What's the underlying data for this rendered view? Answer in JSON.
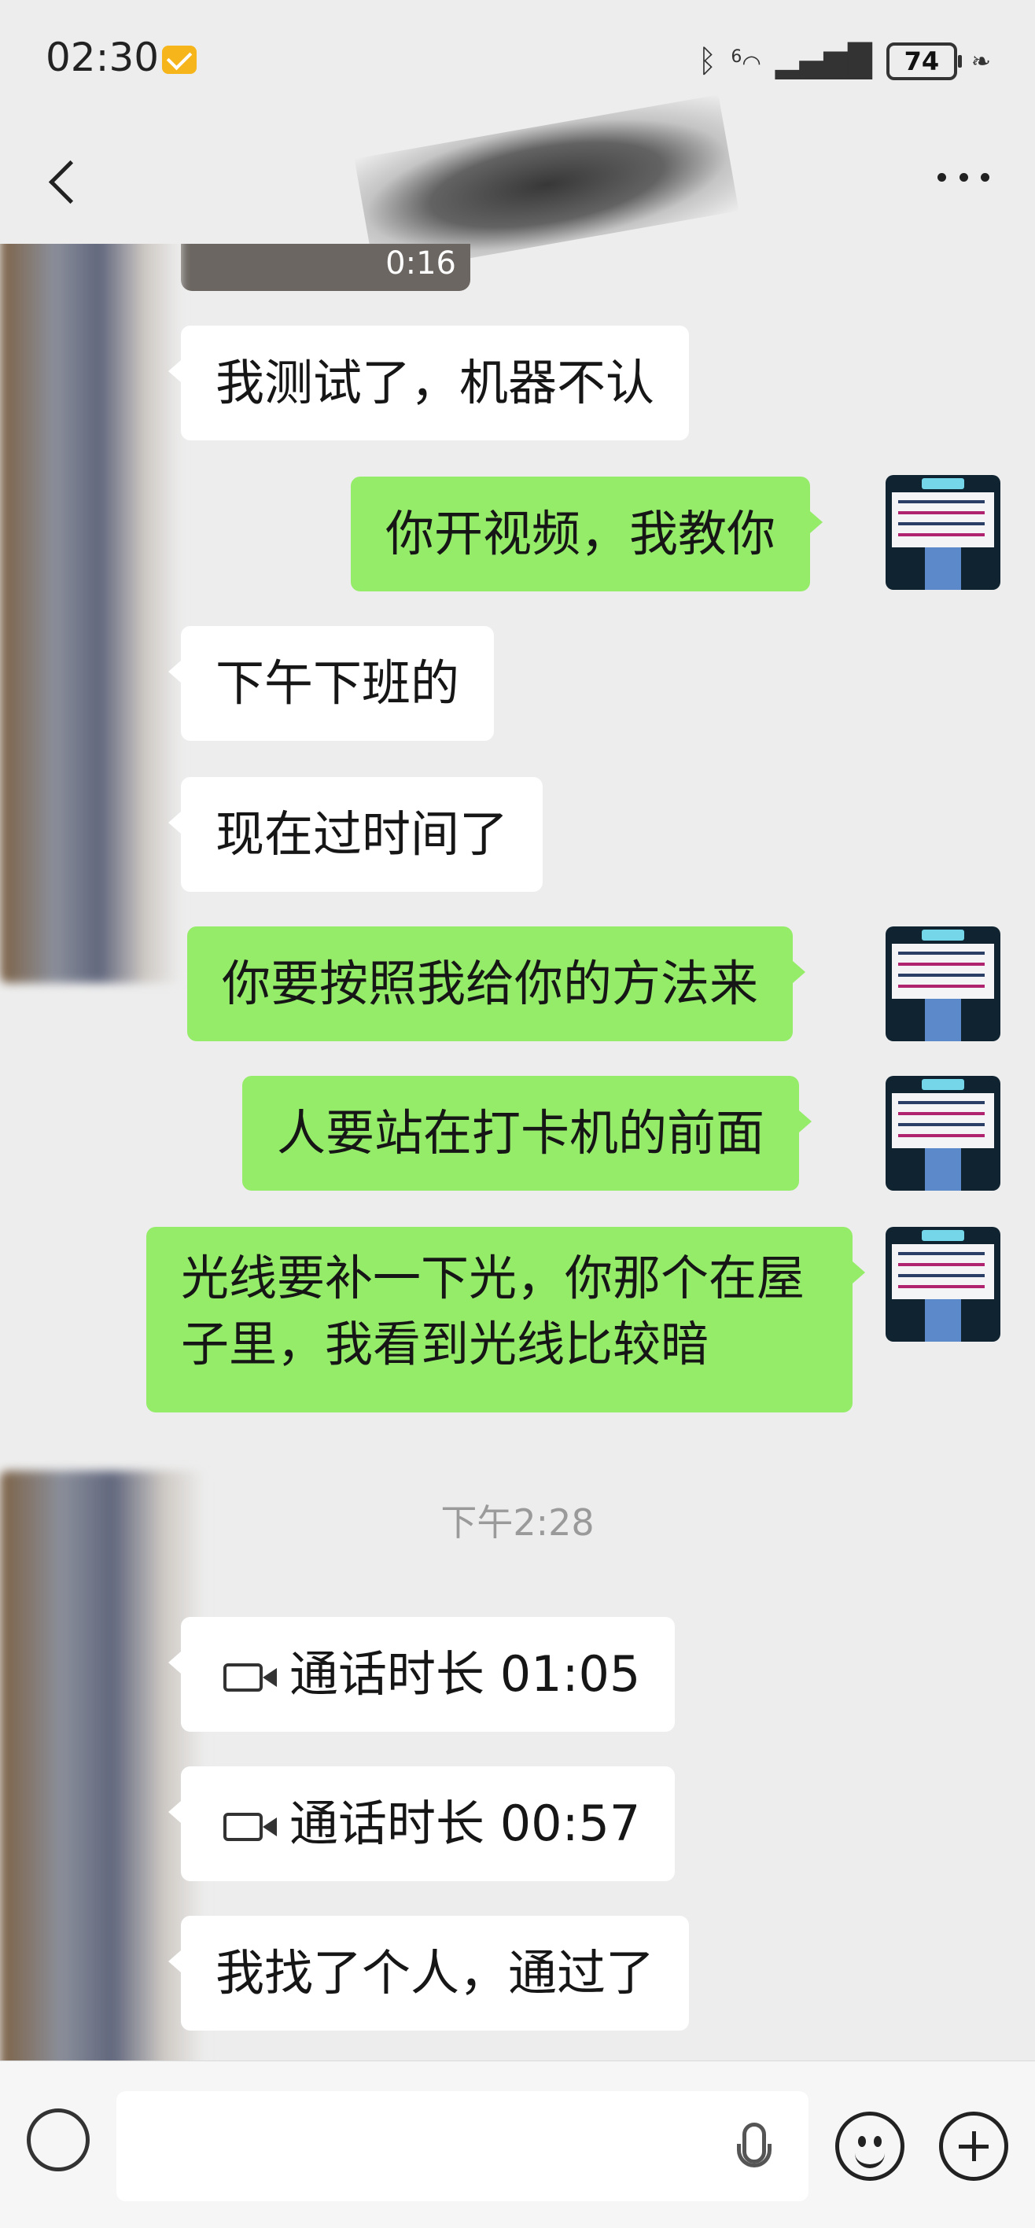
{
  "status_bar": {
    "time": "02:30",
    "network": "6",
    "battery": "74"
  },
  "header": {
    "title": ""
  },
  "video": {
    "duration": "0:16"
  },
  "messages": [
    {
      "side": "left",
      "text": "我测试了，机器不认"
    },
    {
      "side": "right",
      "text": "你开视频，我教你"
    },
    {
      "side": "left",
      "text": "下午下班的"
    },
    {
      "side": "left",
      "text": "现在过时间了"
    },
    {
      "side": "right",
      "text": "你要按照我给你的方法来"
    },
    {
      "side": "right",
      "text": "人要站在打卡机的前面"
    },
    {
      "side": "right",
      "text": "光线要补一下光，你那个在屋子里，我看到光线比较暗"
    }
  ],
  "timestamp": "下午2:28",
  "calls": [
    {
      "label": "通话时长 01:05"
    },
    {
      "label": "通话时长 00:57"
    }
  ],
  "last_message": "我找了个人，通过了",
  "input": {
    "placeholder": ""
  },
  "icons": {
    "back": "back-arrow-icon",
    "more": "more-icon",
    "call": "video-call-icon",
    "mic": "microphone-icon",
    "emoji": "emoji-icon",
    "plus": "plus-icon"
  },
  "colors": {
    "background": "#ededed",
    "bubble_left": "#ffffff",
    "bubble_right": "#95ec69"
  }
}
